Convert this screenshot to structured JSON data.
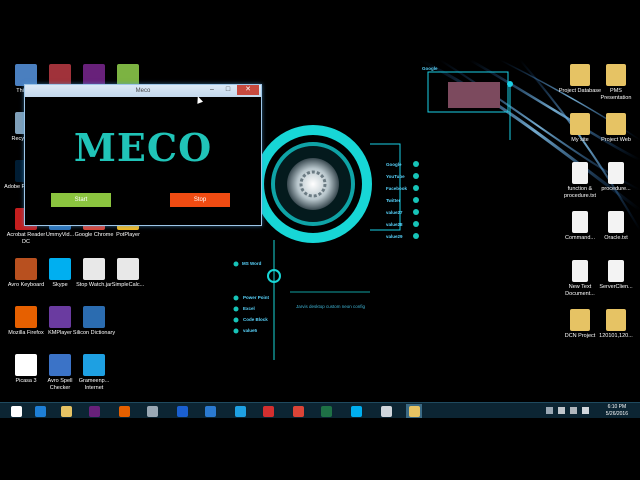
{
  "window": {
    "title": "Meco",
    "minimize": "–",
    "maximize": "□",
    "close": "✕",
    "logo": "MECO",
    "start_label": "Start",
    "stop_label": "Stop"
  },
  "desktop_left": [
    {
      "label": "This PC",
      "icon": "computer-icon",
      "color": "#4a7fbf"
    },
    {
      "label": "",
      "icon": "winrar-icon",
      "color": "#a0323a"
    },
    {
      "label": "",
      "icon": "visual-studio-icon",
      "color": "#68217a"
    },
    {
      "label": "",
      "icon": "android-icon",
      "color": "#7cb342"
    },
    {
      "label": "Recycle Bin",
      "icon": "recycle-bin-icon",
      "color": "#7f9fb8"
    },
    {
      "label": "Adobe Photoshop",
      "icon": "photoshop-icon",
      "color": "#001d34"
    },
    {
      "label": "Acrobat Reader DC",
      "icon": "acrobat-icon",
      "color": "#c41e1e"
    },
    {
      "label": "UmmyVid...",
      "icon": "ummy-icon",
      "color": "#2d72b8"
    },
    {
      "label": "Google Chrome",
      "icon": "chrome-icon",
      "color": "#db4437"
    },
    {
      "label": "PotPlayer",
      "icon": "potplayer-icon",
      "color": "#f2b822"
    },
    {
      "label": "Avro Keyboard",
      "icon": "avro-icon",
      "color": "#b8501f"
    },
    {
      "label": "Skype",
      "icon": "skype-icon",
      "color": "#00aff0"
    },
    {
      "label": "Stop Watch.jar",
      "icon": "java-icon",
      "color": "#e8e8e8"
    },
    {
      "label": "SimpleCalc...",
      "icon": "java-icon",
      "color": "#e8e8e8"
    },
    {
      "label": "Mozilla Firefox",
      "icon": "firefox-icon",
      "color": "#e66000"
    },
    {
      "label": "KMPlayer",
      "icon": "kmplayer-icon",
      "color": "#6a3ba0"
    },
    {
      "label": "Silicon Dictionary",
      "icon": "dictionary-icon",
      "color": "#2b6cb0"
    },
    {
      "label": "Picasa 3",
      "icon": "picasa-icon",
      "color": "#ffffff"
    },
    {
      "label": "Avro Spell Checker",
      "icon": "spell-checker-icon",
      "color": "#3b73c7"
    },
    {
      "label": "Grameenp... Internet",
      "icon": "grameenphone-icon",
      "color": "#1ea0e2"
    }
  ],
  "desktop_right": [
    {
      "label": "Project Database",
      "icon": "folder-icon",
      "color": "#e6c364"
    },
    {
      "label": "PMS Presentation",
      "icon": "folder-icon",
      "color": "#e6c364"
    },
    {
      "label": "My site",
      "icon": "folder-icon",
      "color": "#e6c364"
    },
    {
      "label": "Project Web",
      "icon": "folder-icon",
      "color": "#e6c364"
    },
    {
      "label": "function & procedure.txt",
      "icon": "text-file-icon",
      "color": "#f3f3f3"
    },
    {
      "label": "procedure...",
      "icon": "text-file-icon",
      "color": "#f3f3f3"
    },
    {
      "label": "Command...",
      "icon": "text-file-icon",
      "color": "#f3f3f3"
    },
    {
      "label": "Oracle.txt",
      "icon": "text-file-icon",
      "color": "#f3f3f3"
    },
    {
      "label": "New Text Document...",
      "icon": "text-file-icon",
      "color": "#f3f3f3"
    },
    {
      "label": "ServerClien...",
      "icon": "text-file-icon",
      "color": "#f3f3f3"
    },
    {
      "label": "DCN Project",
      "icon": "folder-icon",
      "color": "#e6c364"
    },
    {
      "label": "120101,120...",
      "icon": "folder-icon",
      "color": "#e6c364"
    }
  ],
  "hud": {
    "top_label": "Google",
    "right_links": [
      "Google",
      "YouTube",
      "Facebook",
      "Twitter",
      "value27",
      "value28",
      "value29"
    ],
    "left_top": "MS Word",
    "left_links": [
      "Power Point",
      "Excel",
      "Code Block",
      "value5"
    ],
    "bottom_text": "Jarvis desktop custom neon config"
  },
  "taskbar": {
    "items": [
      {
        "name": "start-button",
        "color": "#ffffff"
      },
      {
        "name": "internet-explorer-icon",
        "color": "#1e7fd6"
      },
      {
        "name": "file-explorer-icon",
        "color": "#e6c364"
      },
      {
        "name": "visual-studio-icon",
        "color": "#68217a"
      },
      {
        "name": "firefox-icon",
        "color": "#e66000"
      },
      {
        "name": "app-grid-icon",
        "color": "#9aa8b4"
      },
      {
        "name": "d-app-icon",
        "color": "#1a5fd0"
      },
      {
        "name": "image-app-icon",
        "color": "#2b7ad0"
      },
      {
        "name": "grameenphone-icon",
        "color": "#1ea0e2"
      },
      {
        "name": "download-icon",
        "color": "#d32f2f"
      },
      {
        "name": "chrome-icon",
        "color": "#db4437"
      },
      {
        "name": "excel-icon",
        "color": "#1e7145"
      },
      {
        "name": "skype-icon",
        "color": "#00aff0"
      },
      {
        "name": "window-app-icon",
        "color": "#d0d6dc"
      },
      {
        "name": "meco-app-icon",
        "color": "#e6c364"
      }
    ],
    "time": "6:10 PM",
    "date": "5/26/2016"
  }
}
